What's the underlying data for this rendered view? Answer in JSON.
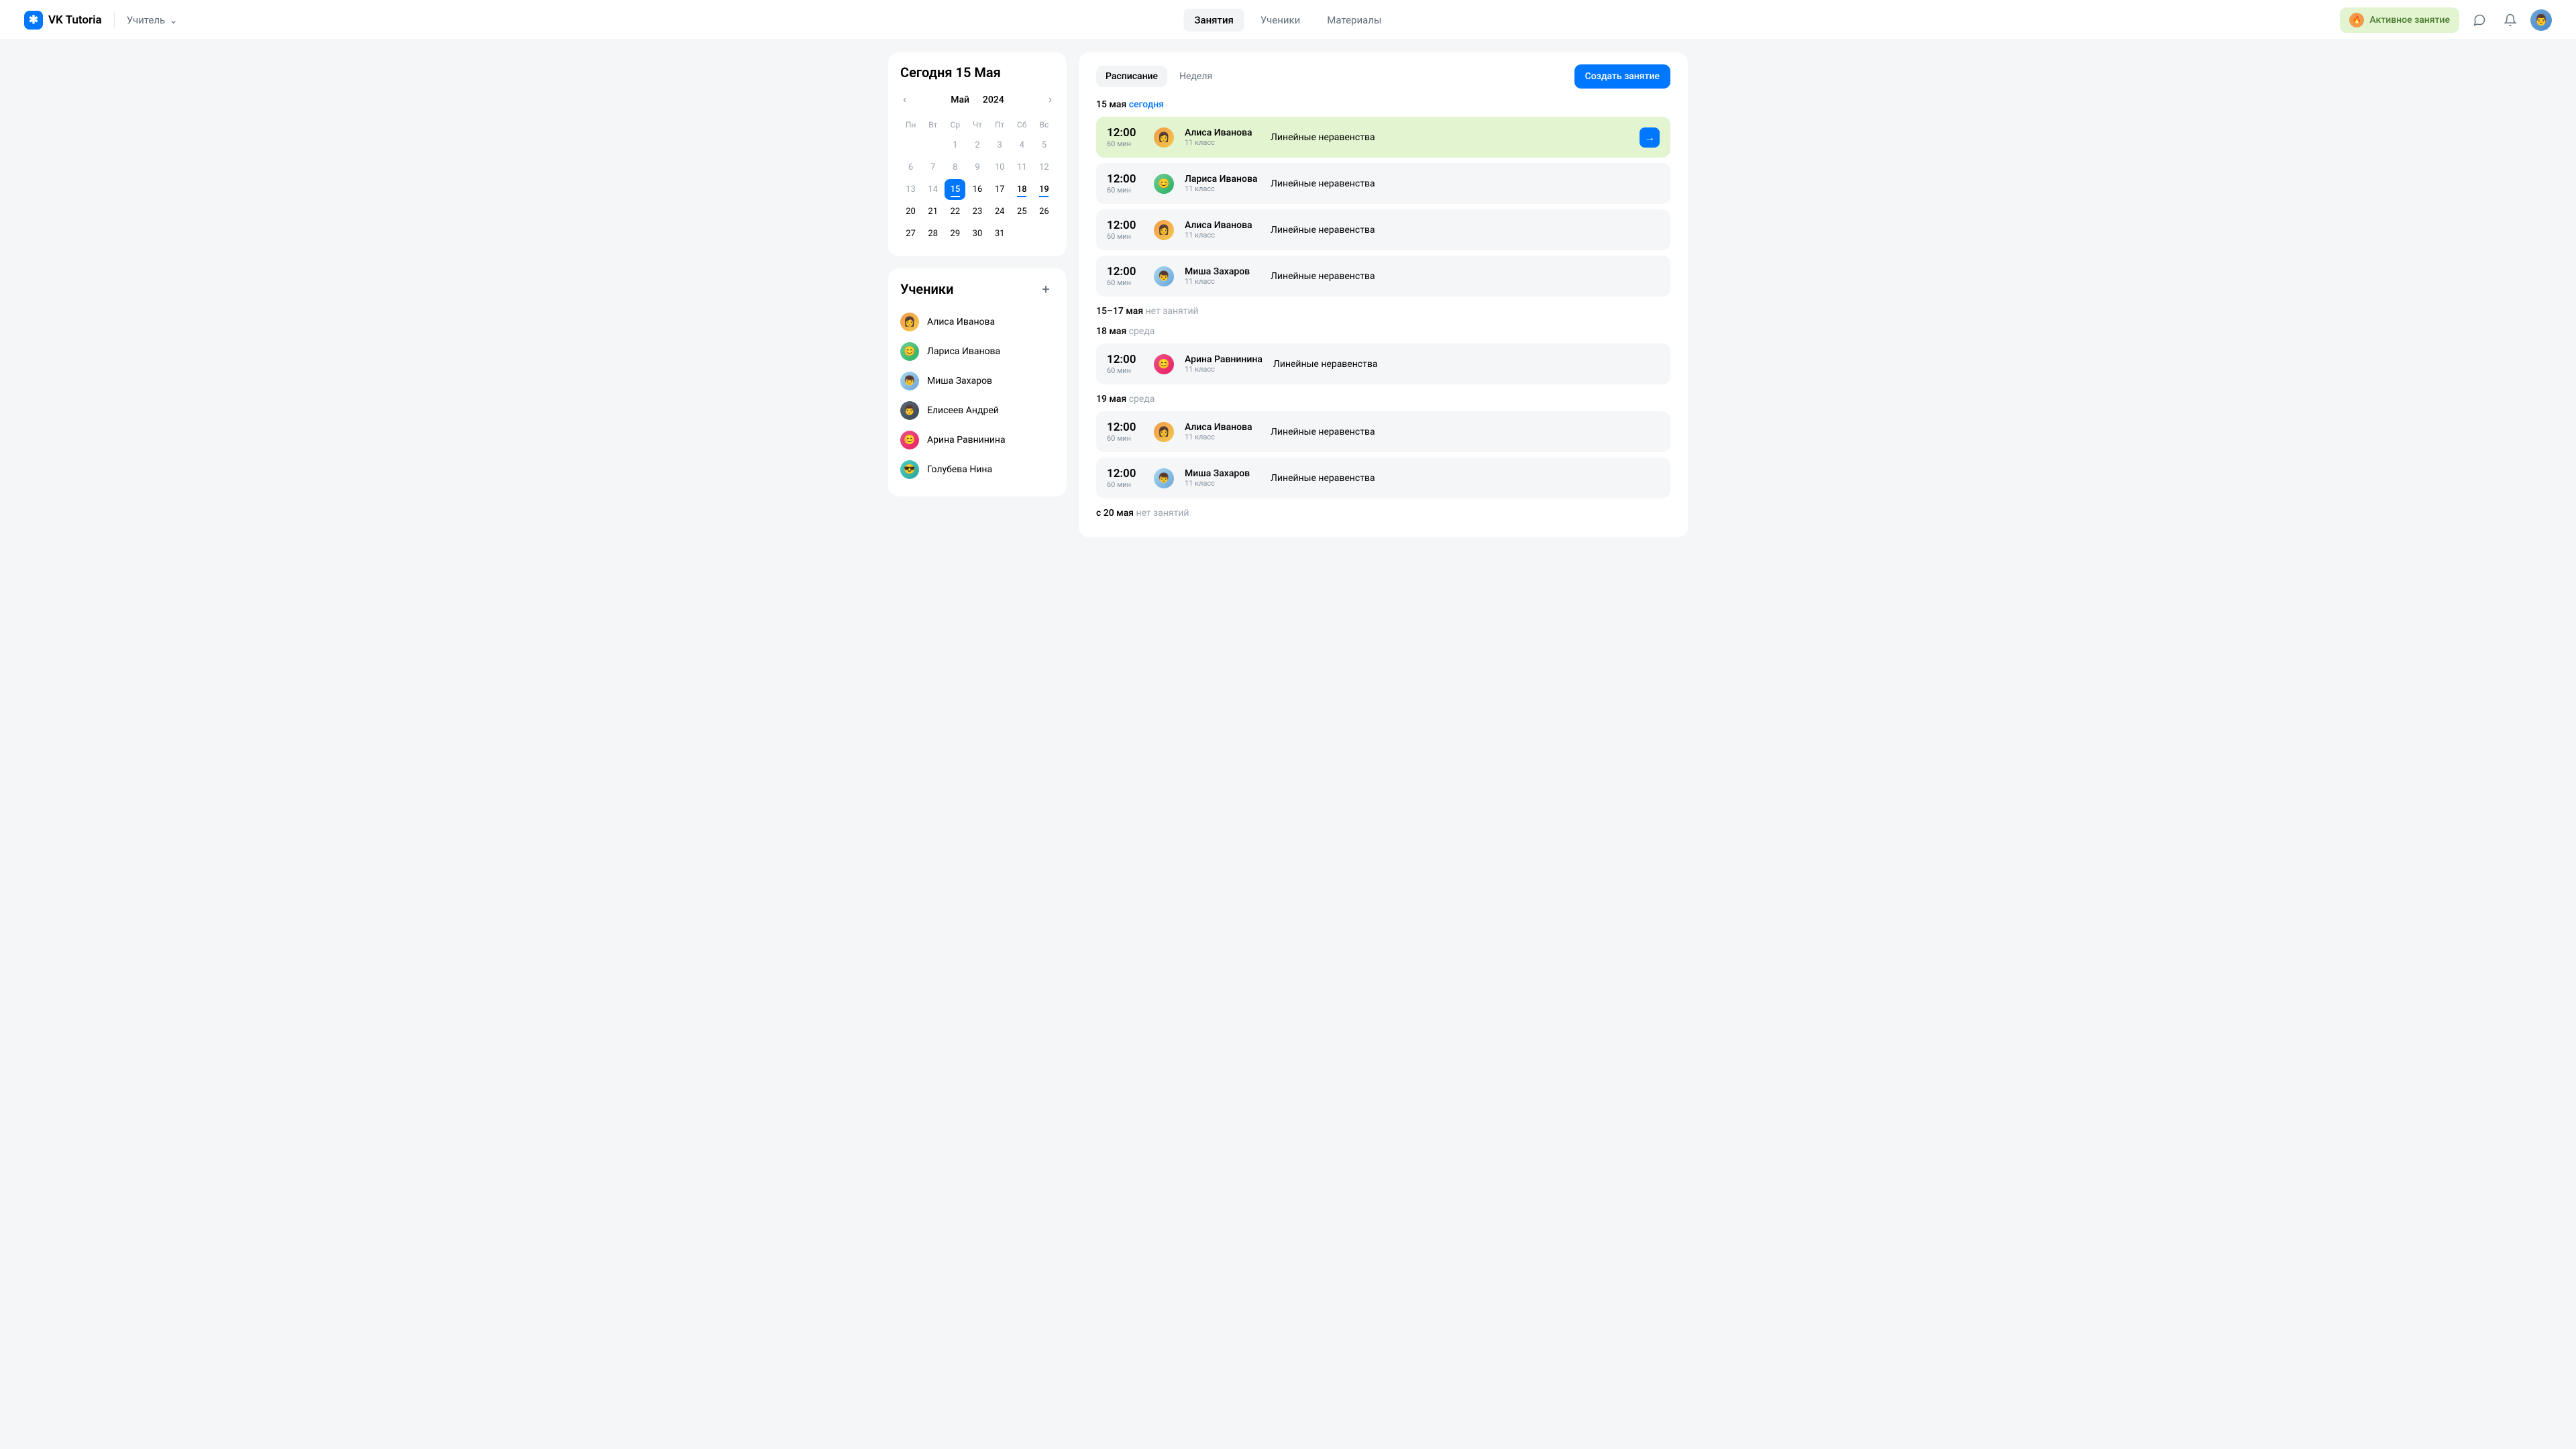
{
  "header": {
    "brand": "VK Tutoria",
    "role": "Учитель",
    "nav": [
      "Занятия",
      "Ученики",
      "Материалы"
    ],
    "activeLessonLabel": "Активное занятие"
  },
  "calendar": {
    "todayTitle": "Сегодня 15 Мая",
    "month": "Май",
    "year": "2024",
    "dow": [
      "Пн",
      "Вт",
      "Ср",
      "Чт",
      "Пт",
      "Сб",
      "Вс"
    ],
    "weeks": [
      [
        null,
        null,
        {
          "d": "1",
          "muted": true
        },
        {
          "d": "2",
          "muted": true
        },
        {
          "d": "3",
          "muted": true
        },
        {
          "d": "4",
          "muted": true
        },
        {
          "d": "5",
          "muted": true
        }
      ],
      [
        {
          "d": "6",
          "muted": true
        },
        {
          "d": "7",
          "muted": true
        },
        {
          "d": "8",
          "muted": true
        },
        {
          "d": "9",
          "muted": true
        },
        {
          "d": "10",
          "muted": true
        },
        {
          "d": "11",
          "muted": true
        },
        {
          "d": "12",
          "muted": true
        }
      ],
      [
        {
          "d": "13",
          "muted": true
        },
        {
          "d": "14",
          "muted": true
        },
        {
          "d": "15",
          "selected": true,
          "marked": true
        },
        {
          "d": "16"
        },
        {
          "d": "17"
        },
        {
          "d": "18",
          "marked": true
        },
        {
          "d": "19",
          "marked": true
        }
      ],
      [
        {
          "d": "20"
        },
        {
          "d": "21"
        },
        {
          "d": "22"
        },
        {
          "d": "23"
        },
        {
          "d": "24"
        },
        {
          "d": "25"
        },
        {
          "d": "26"
        }
      ],
      [
        {
          "d": "27"
        },
        {
          "d": "28"
        },
        {
          "d": "29"
        },
        {
          "d": "30"
        },
        {
          "d": "31"
        },
        null,
        null
      ]
    ]
  },
  "students": {
    "title": "Ученики",
    "list": [
      {
        "name": "Алиса Иванова",
        "avatar": "orange",
        "emoji": "👩"
      },
      {
        "name": "Лариса Иванова",
        "avatar": "green",
        "emoji": "😊"
      },
      {
        "name": "Миша Захаров",
        "avatar": "blue",
        "emoji": "👦"
      },
      {
        "name": "Елисеев Андрей",
        "avatar": "dark",
        "emoji": "👨"
      },
      {
        "name": "Арина Равнинина",
        "avatar": "pink",
        "emoji": "😊"
      },
      {
        "name": "Голубева Нина",
        "avatar": "teal",
        "emoji": "😎"
      }
    ]
  },
  "schedule": {
    "tabs": [
      "Расписание",
      "Неделя"
    ],
    "createLabel": "Создать занятие",
    "groups": [
      {
        "date": "15 мая",
        "accent": "сегодня",
        "lessons": [
          {
            "time": "12:00",
            "dur": "60 мин",
            "student": "Алиса Иванова",
            "grade": "11 класс",
            "topic": "Линейные неравенства",
            "avatar": "orange",
            "emoji": "👩",
            "active": true
          },
          {
            "time": "12:00",
            "dur": "60 мин",
            "student": "Лариса Иванова",
            "grade": "11 класс",
            "topic": "Линейные неравенства",
            "avatar": "green",
            "emoji": "😊"
          },
          {
            "time": "12:00",
            "dur": "60 мин",
            "student": "Алиса Иванова",
            "grade": "11 класс",
            "topic": "Линейные неравенства",
            "avatar": "orange",
            "emoji": "👩"
          },
          {
            "time": "12:00",
            "dur": "60 мин",
            "student": "Миша Захаров",
            "grade": "11 класс",
            "topic": "Линейные неравенства",
            "avatar": "blue",
            "emoji": "👦"
          }
        ]
      },
      {
        "date": "15–17 мая",
        "muted": "нет занятий",
        "lessons": []
      },
      {
        "date": "18 мая",
        "muted": "среда",
        "lessons": [
          {
            "time": "12:00",
            "dur": "60 мин",
            "student": "Арина Равнинина",
            "grade": "11 класс",
            "topic": "Линейные неравенства",
            "avatar": "pink",
            "emoji": "😊"
          }
        ]
      },
      {
        "date": "19 мая",
        "muted": "среда",
        "lessons": [
          {
            "time": "12:00",
            "dur": "60 мин",
            "student": "Алиса Иванова",
            "grade": "11 класс",
            "topic": "Линейные неравенства",
            "avatar": "orange",
            "emoji": "👩"
          },
          {
            "time": "12:00",
            "dur": "60 мин",
            "student": "Миша Захаров",
            "grade": "11 класс",
            "topic": "Линейные неравенства",
            "avatar": "blue",
            "emoji": "👦"
          }
        ]
      },
      {
        "date": "с 20 мая",
        "muted": "нет занятий",
        "lessons": []
      }
    ]
  }
}
